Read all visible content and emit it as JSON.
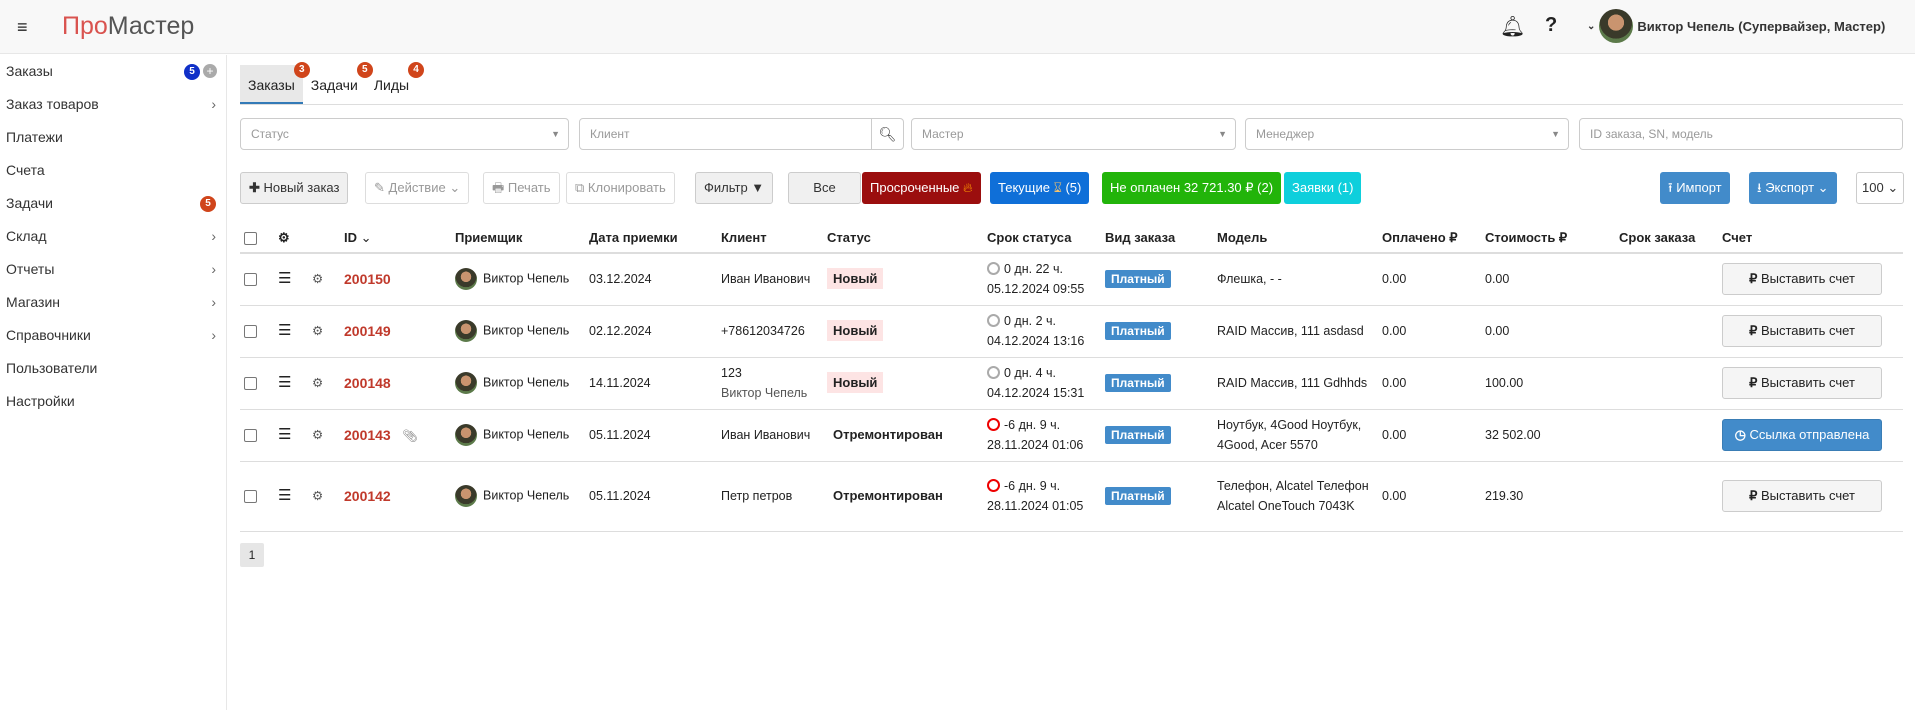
{
  "header": {
    "logo_pro": "Про",
    "logo_master": "Мастер",
    "user_name": "Виктор Чепель (Супервайзер, Мастер)"
  },
  "sidebar": {
    "items": [
      {
        "label": "Заказы",
        "badge": "5"
      },
      {
        "label": "Заказ товаров"
      },
      {
        "label": "Платежи"
      },
      {
        "label": "Счета"
      },
      {
        "label": "Задачи",
        "badge": "5"
      },
      {
        "label": "Склад"
      },
      {
        "label": "Отчеты"
      },
      {
        "label": "Магазин"
      },
      {
        "label": "Справочники"
      },
      {
        "label": "Пользователи"
      },
      {
        "label": "Настройки"
      }
    ]
  },
  "tabs": [
    {
      "label": "Заказы",
      "badge": "3"
    },
    {
      "label": "Задачи",
      "badge": "5"
    },
    {
      "label": "Лиды",
      "badge": "4"
    }
  ],
  "filters": {
    "status": "Статус",
    "client": "Клиент",
    "master": "Мастер",
    "manager": "Менеджер",
    "search": "ID заказа, SN, модель"
  },
  "toolbar": {
    "new_order": "Новый заказ",
    "action": "Действие",
    "print": "Печать",
    "clone": "Клонировать",
    "filter": "Фильтр",
    "all": "Все",
    "overdue": "Просроченные",
    "current": "Текущие",
    "current_count": "(5)",
    "unpaid": "Не оплачен 32 721.30 ₽ (2)",
    "requests": "Заявки (1)",
    "import": "Импорт",
    "export": "Экспорт",
    "per_page": "100"
  },
  "colors": {
    "overdue": "#9b0e0e",
    "current": "#0f6fd8",
    "unpaid": "#22b40a",
    "requests": "#0ecfdc",
    "import": "#428bca"
  },
  "table": {
    "headers": [
      "ID",
      "Приемщик",
      "Дата приемки",
      "Клиент",
      "Статус",
      "Срок статуса",
      "Вид заказа",
      "Модель",
      "Оплачено ₽",
      "Стоимость ₽",
      "Срок заказа",
      "Счет"
    ],
    "rows": [
      {
        "id": "200150",
        "receiver": "Виктор Чепель",
        "date": "03.12.2024",
        "client": "Иван Иванович",
        "client2": "",
        "status": "Новый",
        "term": "0 дн. 22 ч.",
        "term_date": "05.12.2024 09:55",
        "overdue": false,
        "type": "Платный",
        "model": "Флешка, - -",
        "paid": "0.00",
        "cost": "0.00",
        "invoice": "Выставить счет",
        "sent": false,
        "clip": false
      },
      {
        "id": "200149",
        "receiver": "Виктор Чепель",
        "date": "02.12.2024",
        "client": "+78612034726",
        "client2": "",
        "status": "Новый",
        "term": "0 дн. 2 ч.",
        "term_date": "04.12.2024 13:16",
        "overdue": false,
        "type": "Платный",
        "model": "RAID Массив, 111 asdasd",
        "paid": "0.00",
        "cost": "0.00",
        "invoice": "Выставить счет",
        "sent": false,
        "clip": false
      },
      {
        "id": "200148",
        "receiver": "Виктор Чепель",
        "date": "14.11.2024",
        "client": "123",
        "client2": "Виктор Чепель",
        "status": "Новый",
        "term": "0 дн. 4 ч.",
        "term_date": "04.12.2024 15:31",
        "overdue": false,
        "type": "Платный",
        "model": "RAID Массив, 111 Gdhhds",
        "paid": "0.00",
        "cost": "100.00",
        "invoice": "Выставить счет",
        "sent": false,
        "clip": false
      },
      {
        "id": "200143",
        "receiver": "Виктор Чепель",
        "date": "05.11.2024",
        "client": "Иван Иванович",
        "client2": "",
        "status": "Отремонтирован",
        "term": "-6 дн. 9 ч.",
        "term_date": "28.11.2024 01:06",
        "overdue": true,
        "type": "Платный",
        "model": "Ноутбук, 4Good Ноутбук, 4Good, Acer 5570",
        "paid": "0.00",
        "cost": "32 502.00",
        "invoice": "Ссылка отправлена",
        "sent": true,
        "clip": true
      },
      {
        "id": "200142",
        "receiver": "Виктор Чепель",
        "date": "05.11.2024",
        "client": "Петр петров",
        "client2": "",
        "status": "Отремонтирован",
        "term": "-6 дн. 9 ч.",
        "term_date": "28.11.2024 01:05",
        "overdue": true,
        "type": "Платный",
        "model": "Телефон, Alcatel Телефон Alcatel OneTouch 7043K",
        "paid": "0.00",
        "cost": "219.30",
        "invoice": "Выставить счет",
        "sent": false,
        "clip": false
      }
    ]
  },
  "pagination": {
    "current": "1"
  }
}
